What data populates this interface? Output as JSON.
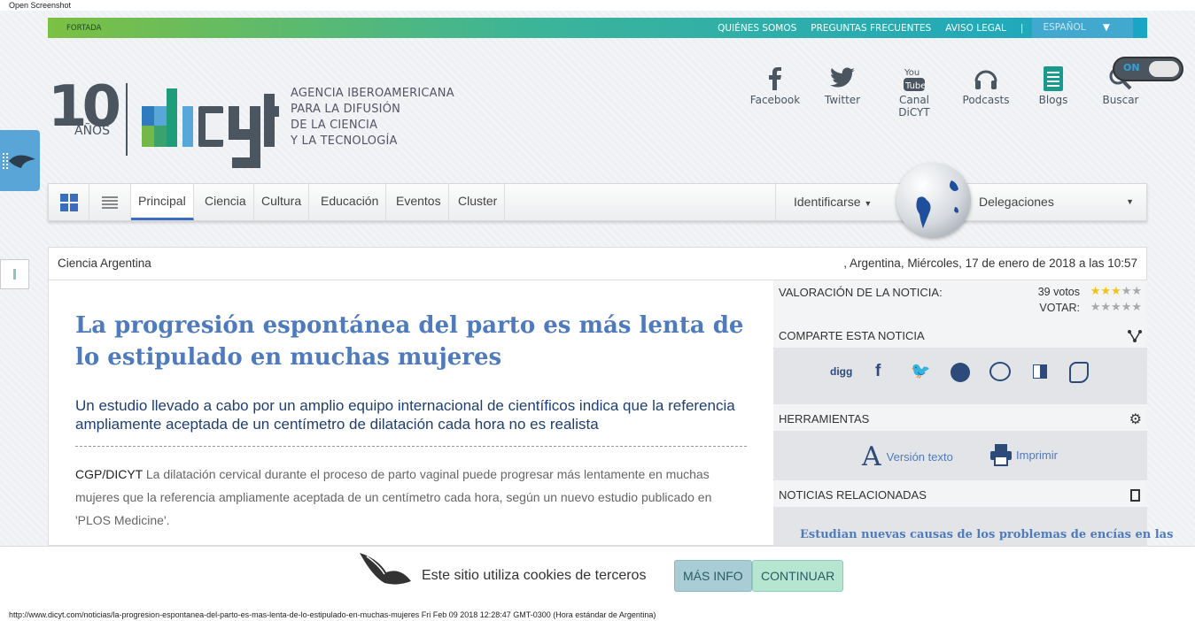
{
  "screenshot_label": "Open Screenshot",
  "topbar": {
    "home": "FORTADA",
    "links": [
      "QUIÉNES SOMOS",
      "PREGUNTAS FRECUENTES",
      "AVISO LEGAL"
    ],
    "language": "ESPAÑOL"
  },
  "logo": {
    "anniversary": "10",
    "anniversary_label": "AÑOS",
    "brand": "dicyt"
  },
  "agency_lines": [
    "AGENCIA IBEROAMERICANA",
    "PARA LA DIFUSIÓN",
    "DE LA CIENCIA",
    "Y LA TECNOLOGÍA"
  ],
  "social": [
    {
      "label": "Facebook",
      "icon": "facebook-icon"
    },
    {
      "label": "Twitter",
      "icon": "twitter-icon"
    },
    {
      "label": "Canal DiCYT",
      "icon": "youtube-icon"
    },
    {
      "label": "Podcasts",
      "icon": "headphones-icon"
    },
    {
      "label": "Blogs",
      "icon": "blog-icon"
    },
    {
      "label": "Buscar",
      "icon": "search-icon"
    }
  ],
  "toggle": {
    "label": "ON"
  },
  "nav": {
    "items": [
      "Principal",
      "Ciencia",
      "Cultura",
      "Educación",
      "Eventos",
      "Cluster"
    ],
    "login": "Identificarse",
    "delegations": "Delegaciones"
  },
  "crumb": {
    "section": "Ciencia Argentina",
    "dateline": ", Argentina, Miércoles, 17 de enero de 2018 a las 10:57"
  },
  "article": {
    "title": "La progresión espontánea del parto es más lenta de lo estipulado en muchas mujeres",
    "subtitle": "Un estudio llevado a cabo por un amplio equipo internacional de científicos indica que la referencia ampliamente aceptada de un centímetro de dilatación cada hora no es realista",
    "source": "CGP/DICYT",
    "body": " La dilatación cervical durante el proceso de parto vaginal puede progresar más lentamente en muchas mujeres que la referencia ampliamente aceptada de un centímetro cada hora, según un nuevo estudio publicado en 'PLOS Medicine'."
  },
  "sidebar": {
    "rating_label": "VALORACIÓN DE LA NOTICIA:",
    "votes": "39 votos",
    "vote_label": "VOTAR:",
    "rating": 3,
    "share_label": "COMPARTE ESTA NOTICIA",
    "share_icons": [
      "digg",
      "facebook",
      "twitter",
      "stumbleupon",
      "reddit",
      "delicious",
      "evernote"
    ],
    "digg_text": "digg",
    "tools_label": "HERRAMIENTAS",
    "text_version": "Versión texto",
    "print": "Imprimir",
    "related_label": "NOTICIAS RELACIONADAS",
    "related_first": "Estudian nuevas causas de los problemas de encías en las"
  },
  "cookie": {
    "text": "Este sitio utiliza cookies de terceros",
    "more": "MÁS INFO",
    "continue": "CONTINUAR"
  },
  "footer_url": "http://www.dicyt.com/noticias/la-progresion-espontanea-del-parto-es-mas-lenta-de-lo-estipulado-en-muchas-mujeres Fri Feb 09 2018 12:28:47 GMT-0300 (Hora estándar de Argentina)",
  "colors": {
    "accent": "#4f7bbd",
    "dark": "#1f3f70",
    "star": "#f3c317"
  }
}
